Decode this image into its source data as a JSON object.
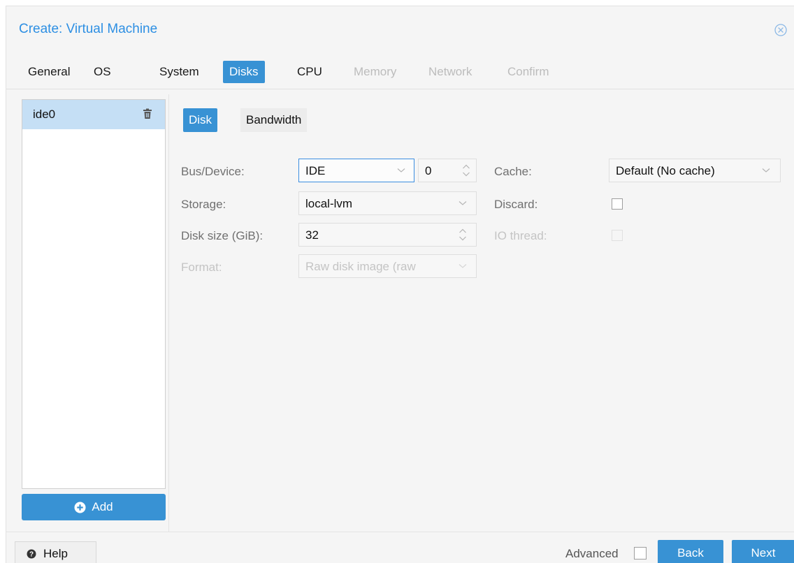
{
  "dialog": {
    "title": "Create: Virtual Machine",
    "close_icon": "close-circle-icon"
  },
  "wizard_tabs": [
    {
      "label": "General",
      "state": "normal"
    },
    {
      "label": "OS",
      "state": "normal"
    },
    {
      "label": "System",
      "state": "normal"
    },
    {
      "label": "Disks",
      "state": "active"
    },
    {
      "label": "CPU",
      "state": "normal"
    },
    {
      "label": "Memory",
      "state": "disabled"
    },
    {
      "label": "Network",
      "state": "disabled"
    },
    {
      "label": "Confirm",
      "state": "disabled"
    }
  ],
  "disk_list": {
    "items": [
      {
        "label": "ide0",
        "selected": true,
        "icon": "trash-icon"
      }
    ],
    "add_label": "Add",
    "add_icon": "plus-circle-icon"
  },
  "sub_tabs": [
    {
      "label": "Disk",
      "state": "active"
    },
    {
      "label": "Bandwidth",
      "state": "inactive"
    }
  ],
  "form": {
    "bus_device": {
      "label": "Bus/Device:",
      "bus": "IDE",
      "device": "0"
    },
    "storage": {
      "label": "Storage:",
      "value": "local-lvm"
    },
    "disk_size": {
      "label": "Disk size (GiB):",
      "value": "32"
    },
    "format": {
      "label": "Format:",
      "value": "Raw disk image (raw",
      "disabled": true
    },
    "cache": {
      "label": "Cache:",
      "value": "Default (No cache)"
    },
    "discard": {
      "label": "Discard:",
      "checked": false
    },
    "io_thread": {
      "label": "IO thread:",
      "checked": false,
      "disabled": true
    }
  },
  "footer": {
    "help_label": "Help",
    "help_icon": "question-circle-icon",
    "advanced_label": "Advanced",
    "advanced_checked": false,
    "back_label": "Back",
    "next_label": "Next"
  },
  "colors": {
    "accent": "#3892d4",
    "title": "#2d8fe3",
    "selected_row": "#c5dff5",
    "focus_border": "#3b8ee0"
  }
}
